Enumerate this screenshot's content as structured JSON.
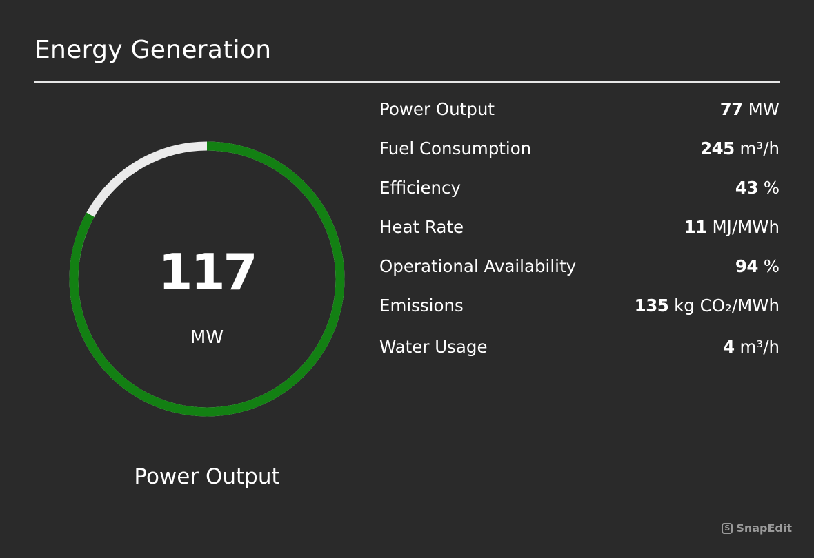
{
  "header": {
    "title": "Energy Generation"
  },
  "gauge": {
    "value": "117",
    "unit": "MW",
    "label": "Power Output",
    "fill_fraction": 0.83,
    "fill_color": "#138013",
    "track_color": "#ebebeb"
  },
  "metrics": [
    {
      "label": "Power Output",
      "value": "77",
      "unit": "MW"
    },
    {
      "label": "Fuel Consumption",
      "value": "245",
      "unit": "m³/h"
    },
    {
      "label": "Efficiency",
      "value": "43",
      "unit": "%"
    },
    {
      "label": "Heat Rate",
      "value": "11",
      "unit": "MJ/MWh"
    },
    {
      "label": "Operational Availability",
      "value": "94",
      "unit": "%"
    },
    {
      "label": "Emissions",
      "value": "135",
      "unit": "kg CO₂/MWh"
    },
    {
      "label": "Water Usage",
      "value": "4",
      "unit": "m³/h"
    }
  ],
  "watermark": {
    "text": "SnapEdit",
    "icon": "snapedit-logo-icon"
  }
}
